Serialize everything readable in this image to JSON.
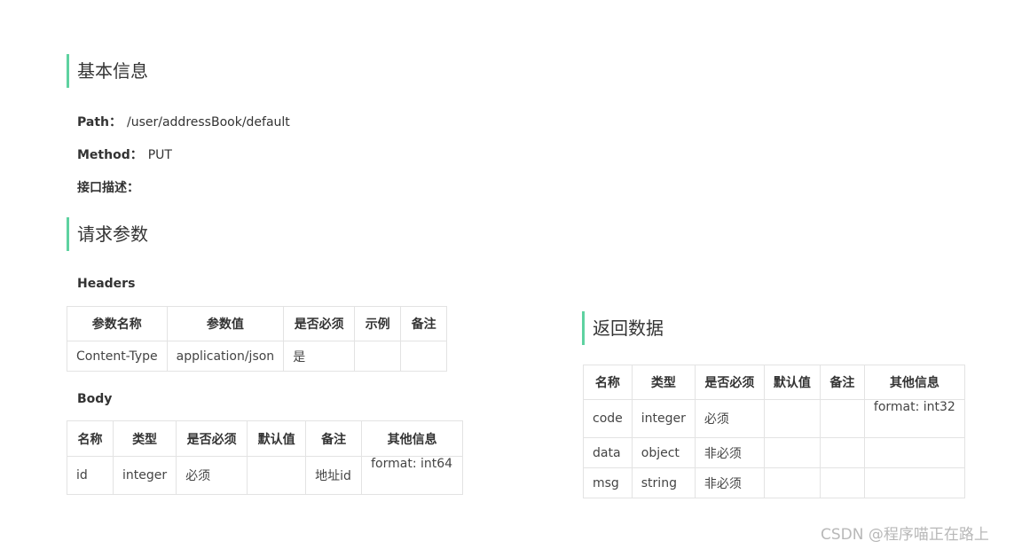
{
  "basic": {
    "title": "基本信息",
    "path_label": "Path：",
    "path_value": "/user/addressBook/default",
    "method_label": "Method：",
    "method_value": "PUT",
    "desc_label": "接口描述："
  },
  "request": {
    "title": "请求参数",
    "headers_title": "Headers",
    "headers_columns": [
      "参数名称",
      "参数值",
      "是否必须",
      "示例",
      "备注"
    ],
    "headers_rows": [
      [
        "Content-Type",
        "application/json",
        "是",
        "",
        ""
      ]
    ],
    "body_title": "Body",
    "body_columns": [
      "名称",
      "类型",
      "是否必须",
      "默认值",
      "备注",
      "其他信息"
    ],
    "body_rows": [
      [
        "id",
        "integer",
        "必须",
        "",
        "地址id",
        "format: int64"
      ]
    ]
  },
  "response": {
    "title": "返回数据",
    "columns": [
      "名称",
      "类型",
      "是否必须",
      "默认值",
      "备注",
      "其他信息"
    ],
    "rows": [
      [
        "code",
        "integer",
        "必须",
        "",
        "",
        "format: int32"
      ],
      [
        "data",
        "object",
        "非必须",
        "",
        "",
        ""
      ],
      [
        "msg",
        "string",
        "非必须",
        "",
        "",
        ""
      ]
    ]
  },
  "watermark": "CSDN @程序喵正在路上",
  "colors": {
    "accent": "#5ed2a0",
    "border": "#e3e3e3"
  }
}
